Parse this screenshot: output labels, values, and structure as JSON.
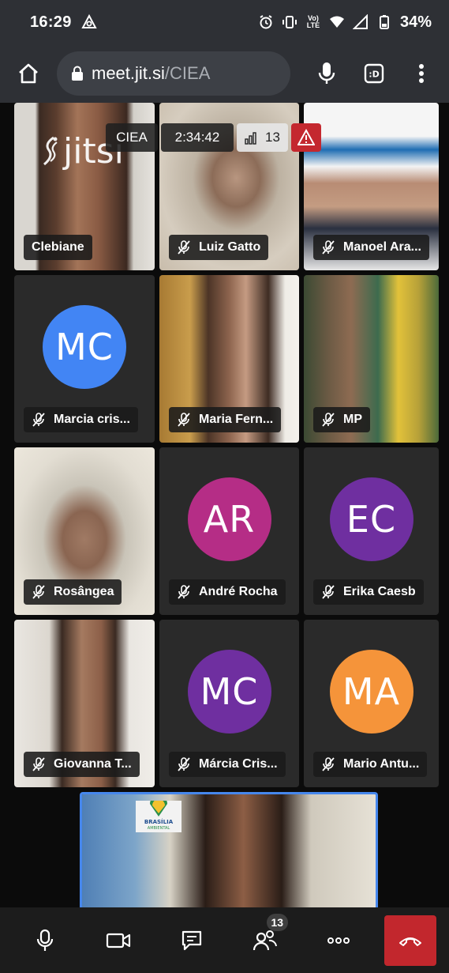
{
  "status_bar": {
    "time": "16:29",
    "network_label": "Vo) LTE",
    "battery": "34%"
  },
  "browser": {
    "url_host": "meet.jit.si",
    "url_path": "/CIEA"
  },
  "conference": {
    "name": "CIEA",
    "timer": "2:34:42",
    "participants_count": "13",
    "logo_text": "jitsi"
  },
  "tiles": [
    {
      "name": "Clebiane",
      "muted": false,
      "initials": ""
    },
    {
      "name": "Luiz Gatto",
      "muted": true,
      "initials": ""
    },
    {
      "name": "Manoel Ara...",
      "muted": true,
      "initials": ""
    },
    {
      "name": "Marcia cris...",
      "muted": true,
      "initials": "MC",
      "color": "#4285f4"
    },
    {
      "name": "Maria Fern...",
      "muted": true,
      "initials": ""
    },
    {
      "name": "MP",
      "muted": true,
      "initials": ""
    },
    {
      "name": "Rosângea",
      "muted": true,
      "initials": ""
    },
    {
      "name": "André Rocha",
      "muted": true,
      "initials": "AR",
      "color": "#b52d86"
    },
    {
      "name": "Erika Caesb",
      "muted": true,
      "initials": "EC",
      "color": "#6f2fa0"
    },
    {
      "name": "Giovanna T...",
      "muted": true,
      "initials": ""
    },
    {
      "name": "Márcia Cris...",
      "muted": true,
      "initials": "MC",
      "color": "#6f2fa0"
    },
    {
      "name": "Mario Antu...",
      "muted": true,
      "initials": "MA",
      "color": "#f5943a"
    }
  ],
  "toolbar": {
    "participants_badge": "13"
  },
  "colors": {
    "accent_blue": "#4687ed",
    "hangup_red": "#c2272d",
    "chrome_bg": "#2e3035"
  }
}
